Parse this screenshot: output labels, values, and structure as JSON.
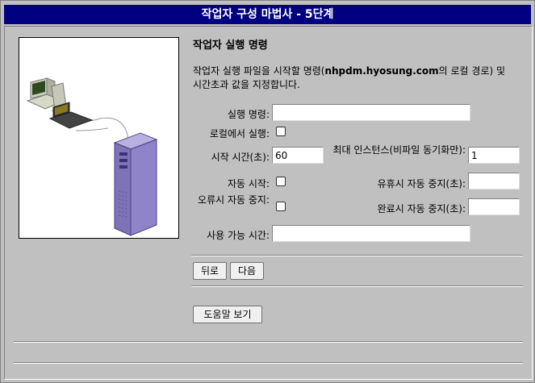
{
  "window": {
    "title": "작업자 구성 마법사 - 5단계"
  },
  "page": {
    "heading": "작업자 실행 명령",
    "description_prefix": "작업자 실행 파일을 시작할 명령(",
    "description_host": "nhpdm.hyosung.com",
    "description_suffix": "의 로컬 경로) 및 시간초과 값을 지정합니다."
  },
  "form": {
    "run_command_label": "실행 명령:",
    "run_command_value": "",
    "run_local_label": "로컬에서 실행:",
    "run_local_checked": false,
    "start_time_label": "시작 시간(초):",
    "start_time_value": "60",
    "max_instances_label": "최대 인스턴스(비파일 동기화만):",
    "max_instances_value": "1",
    "auto_start_label": "자동 시작:",
    "auto_start_checked": false,
    "idle_auto_stop_label": "유휴시 자동 중지(초):",
    "idle_auto_stop_value": "",
    "error_auto_stop_label": "오류시 자동 중지:",
    "error_auto_stop_checked": false,
    "complete_auto_stop_label": "완료시 자동 중지(초):",
    "complete_auto_stop_value": "",
    "available_time_label": "사용 가능 시간:",
    "available_time_value": ""
  },
  "buttons": {
    "back": "뒤로",
    "next": "다음",
    "help": "도움말 보기"
  },
  "icons": {
    "illustration": "server-network-illustration"
  }
}
